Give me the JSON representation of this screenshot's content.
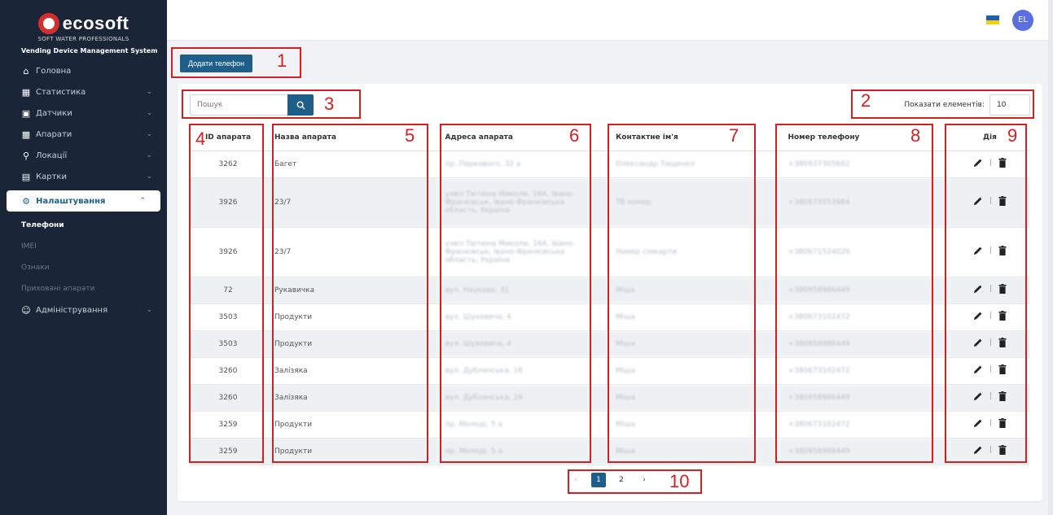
{
  "brand": {
    "name": "ecosoft",
    "tagline": "SOFT WATER PROFESSIONALS",
    "system_title": "Vending Device Management System"
  },
  "sidebar": {
    "items": [
      {
        "label": "Головна",
        "icon": "home-icon",
        "chevron": false
      },
      {
        "label": "Статистика",
        "icon": "chart-icon",
        "chevron": true
      },
      {
        "label": "Датчики",
        "icon": "sensor-icon",
        "chevron": true
      },
      {
        "label": "Апарати",
        "icon": "device-icon",
        "chevron": true
      },
      {
        "label": "Локації",
        "icon": "location-icon",
        "chevron": true
      },
      {
        "label": "Картки",
        "icon": "card-icon",
        "chevron": true
      },
      {
        "label": "Налаштування",
        "icon": "gear-icon",
        "chevron": true,
        "active": true
      },
      {
        "label": "Адміністрування",
        "icon": "users-icon",
        "chevron": true
      }
    ],
    "subitems": [
      "Телефони",
      "IMEI",
      "Ознаки",
      "Приховані апарати"
    ]
  },
  "header": {
    "avatar": "EL"
  },
  "toolbar": {
    "add_label": "Додати телефон"
  },
  "search": {
    "placeholder": "Пошук"
  },
  "show": {
    "label": "Показати елементів:",
    "value": "10"
  },
  "table": {
    "headers": [
      "ID апарата",
      "Назва апарата",
      "Адреса апарата",
      "Контактне ім'я",
      "Номер телефону",
      "Дія"
    ],
    "rows": [
      {
        "id": "3262",
        "name": "Багет",
        "address": "пр. Паркового, 32 а",
        "contact": "Олександр Тищенко",
        "phone": "+380937305682"
      },
      {
        "id": "3926",
        "name": "23/7",
        "address": "узвіз Тютюна Миколи, 16А, Івано-Франківськ, Івано-Франківська область, Україна",
        "contact": "ТВ номер",
        "phone": "+380675553984"
      },
      {
        "id": "3926",
        "name": "23/7",
        "address": "узвіз Тютюна Миколи, 16А, Івано-Франківськ, Івано-Франківська область, Україна",
        "contact": "Номер сімкарти",
        "phone": "+380671524026"
      },
      {
        "id": "72",
        "name": "Рукавичка",
        "address": "вул. Наукова, 31",
        "contact": "Міша",
        "phone": "+380958986449"
      },
      {
        "id": "3503",
        "name": "Продукти",
        "address": "вул. Шухевича, 4",
        "contact": "Міша",
        "phone": "+380673102472"
      },
      {
        "id": "3503",
        "name": "Продукти",
        "address": "вул. Шухевича, 4",
        "contact": "Міша",
        "phone": "+380958986449"
      },
      {
        "id": "3260",
        "name": "Залізяка",
        "address": "вул. Дублянська, 16",
        "contact": "Міша",
        "phone": "+380673102472"
      },
      {
        "id": "3260",
        "name": "Залізяка",
        "address": "вул. Дублянська, 16",
        "contact": "Міша",
        "phone": "+380958986449"
      },
      {
        "id": "3259",
        "name": "Продукти",
        "address": "пр. Молоді, 5 а",
        "contact": "Міша",
        "phone": "+380673102472"
      },
      {
        "id": "3259",
        "name": "Продукти",
        "address": "пр. Молоді, 5 а",
        "contact": "Міша",
        "phone": "+380958986449"
      }
    ]
  },
  "pagination": {
    "prev": "‹",
    "pages": [
      "1",
      "2"
    ],
    "current": "1",
    "next": "›"
  },
  "annotations": [
    "1",
    "2",
    "3",
    "4",
    "5",
    "6",
    "7",
    "8",
    "9",
    "10"
  ],
  "colors": {
    "sidebar": "#1a2538",
    "primary": "#1d5f8a",
    "annotation": "#d32020"
  }
}
